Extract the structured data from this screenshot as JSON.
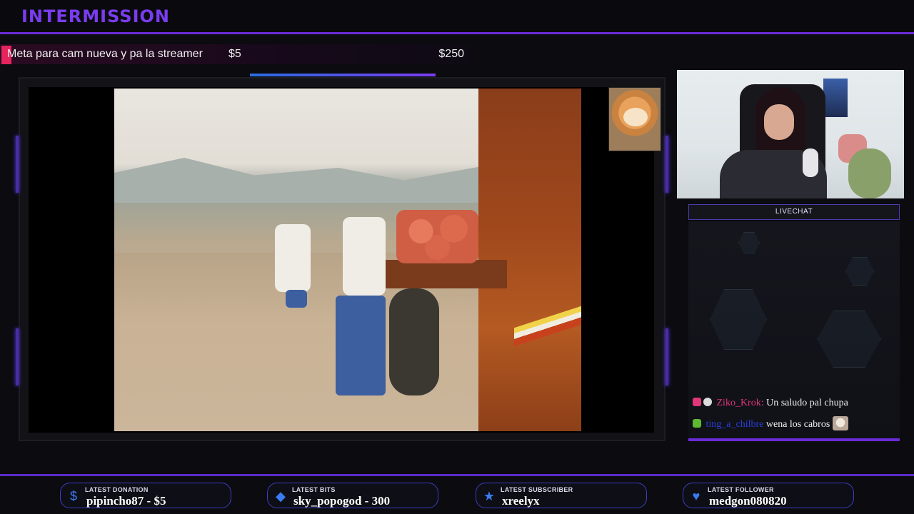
{
  "header": {
    "title": "INTERMISSION"
  },
  "goal": {
    "label": "Meta para cam nueva y pa la streamer",
    "current": "$5",
    "target": "$250",
    "progress_fraction": 0.02,
    "fill_color": "#e6245e"
  },
  "chat": {
    "title": "LIVECHAT",
    "messages": [
      {
        "user": "Ziko_Krok:",
        "text": "Un saludo pal chupa",
        "user_color": "#e0367a"
      },
      {
        "user": "ting_a_chilbre",
        "text": "wena los cabros",
        "user_color": "#2a3fd8"
      }
    ]
  },
  "stats": [
    {
      "label": "LATEST DONATION",
      "value": "pipincho87 - $5",
      "icon": "dollar-icon"
    },
    {
      "label": "LATEST BITS",
      "value": "sky_popogod - 300",
      "icon": "gem-icon"
    },
    {
      "label": "LATEST SUBSCRIBER",
      "value": "xreelyx",
      "icon": "star-icon"
    },
    {
      "label": "LATEST FOLLOWER",
      "value": "medgon080820",
      "icon": "heart-icon"
    }
  ],
  "colors": {
    "accent": "#6b2bd8",
    "title": "#7a3cf0",
    "stat_border": "#3a3fc0"
  }
}
